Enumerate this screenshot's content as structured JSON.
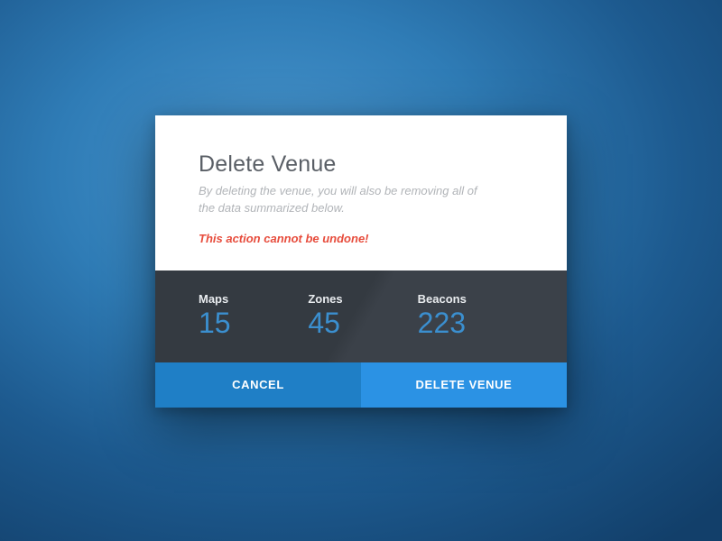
{
  "modal": {
    "title": "Delete Venue",
    "subtitle": "By deleting the venue, you will also be removing all of the data summarized below.",
    "warning": "This action cannot be undone!"
  },
  "stats": {
    "maps": {
      "label": "Maps",
      "value": "15"
    },
    "zones": {
      "label": "Zones",
      "value": "45"
    },
    "beacons": {
      "label": "Beacons",
      "value": "223"
    }
  },
  "actions": {
    "cancel": "CANCEL",
    "delete": "DELETE VENUE"
  }
}
